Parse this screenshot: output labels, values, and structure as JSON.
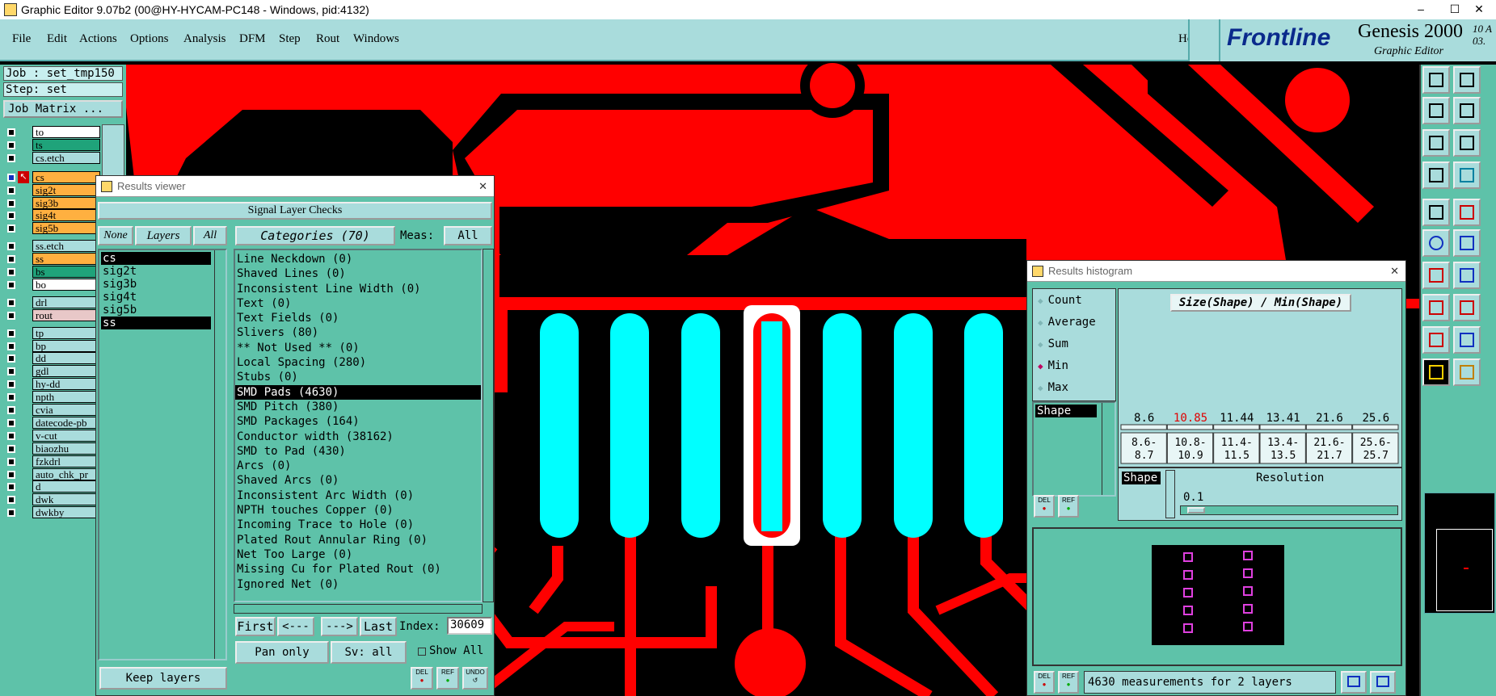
{
  "window": {
    "title": "Graphic Editor 9.07b2 (00@HY-HYCAM-PC148 - Windows, pid:4132)",
    "controls": [
      "–",
      "☐",
      "✕"
    ]
  },
  "menu": {
    "items": [
      "File",
      "Edit",
      "Actions",
      "Options",
      "Analysis",
      "DFM",
      "Step",
      "Rout",
      "Windows"
    ],
    "help": "Help"
  },
  "brand": {
    "logo": "Frontline",
    "product": "Genesis 2000",
    "subtitle": "Graphic Editor",
    "version_line1": "10 A",
    "version_line2": "03."
  },
  "job": {
    "job_label": "Job : set_tmp150",
    "step_label": "Step: set",
    "matrix_button": "Job Matrix ..."
  },
  "layers": [
    {
      "name": "to",
      "color": "#ffffff",
      "row": 0
    },
    {
      "name": "ts",
      "color": "#1fa37a",
      "row": 1
    },
    {
      "name": "cs.etch",
      "color": "#a9dcdc",
      "row": 2
    },
    {
      "name": "cs",
      "color": "#ffb040",
      "row": 3,
      "active": true
    },
    {
      "name": "sig2t",
      "color": "#ffb040",
      "row": 4
    },
    {
      "name": "sig3b",
      "color": "#ffb040",
      "row": 5
    },
    {
      "name": "sig4t",
      "color": "#ffb040",
      "row": 6
    },
    {
      "name": "sig5b",
      "color": "#ffb040",
      "row": 7
    },
    {
      "name": "ss.etch",
      "color": "#a9dcdc",
      "row": 8
    },
    {
      "name": "ss",
      "color": "#ffb040",
      "row": 9
    },
    {
      "name": "bs",
      "color": "#1fa37a",
      "row": 10
    },
    {
      "name": "bo",
      "color": "#ffffff",
      "row": 11
    },
    {
      "name": "drl",
      "color": "#a9dcdc",
      "row": 12
    },
    {
      "name": "rout",
      "color": "#e8c8c8",
      "row": 13
    },
    {
      "name": "tp",
      "color": "#a9dcdc",
      "row": 14
    },
    {
      "name": "bp",
      "color": "#a9dcdc",
      "row": 15
    },
    {
      "name": "dd",
      "color": "#a9dcdc",
      "row": 16
    },
    {
      "name": "gdl",
      "color": "#a9dcdc",
      "row": 17
    },
    {
      "name": "hy-dd",
      "color": "#a9dcdc",
      "row": 18
    },
    {
      "name": "npth",
      "color": "#a9dcdc",
      "row": 19
    },
    {
      "name": "cvia",
      "color": "#a9dcdc",
      "row": 20
    },
    {
      "name": "datecode-pb",
      "color": "#a9dcdc",
      "row": 21
    },
    {
      "name": "v-cut",
      "color": "#a9dcdc",
      "row": 22
    },
    {
      "name": "biaozhu",
      "color": "#a9dcdc",
      "row": 23
    },
    {
      "name": "fzkdrl",
      "color": "#a9dcdc",
      "row": 24
    },
    {
      "name": "auto_chk_pr",
      "color": "#a9dcdc",
      "row": 25
    },
    {
      "name": "d",
      "color": "#a9dcdc",
      "row": 26
    },
    {
      "name": "dwk",
      "color": "#a9dcdc",
      "row": 27
    },
    {
      "name": "dwkby",
      "color": "#a9dcdc",
      "row": 28
    }
  ],
  "results_viewer": {
    "title": "Results viewer",
    "header": "Signal Layer Checks",
    "none_btn": "None",
    "layers_btn": "Layers",
    "all_btn": "All",
    "layer_list": [
      "cs",
      "sig2t",
      "sig3b",
      "sig4t",
      "sig5b",
      "ss"
    ],
    "categories_label": "Categories (70)",
    "meas_label": "Meas:",
    "meas_value": "All",
    "categories": [
      "Line Neckdown (0)",
      "Shaved Lines (0)",
      "Inconsistent Line Width (0)",
      "Text (0)",
      "Text Fields (0)",
      "Slivers (80)",
      "** Not Used ** (0)",
      "Local Spacing (280)",
      "Stubs (0)",
      "SMD Pads (4630)",
      "SMD Pitch (380)",
      "SMD Packages (164)",
      "Conductor width (38162)",
      "SMD to Pad (430)",
      "Arcs (0)",
      "Shaved Arcs (0)",
      "Inconsistent Arc Width (0)",
      "NPTH touches Copper (0)",
      "Incoming Trace to Hole (0)",
      "Plated Rout Annular Ring (0)",
      "Net Too Large (0)",
      "Missing Cu for Plated Rout (0)",
      "Ignored Net (0)"
    ],
    "selected_category_index": 9,
    "first_btn": "First",
    "prev_btn": "<---",
    "next_btn": "--->",
    "last_btn": "Last",
    "index_label": "Index:",
    "index_value": "30609",
    "pan_value": "Pan only",
    "sv_label": "Sv:",
    "sv_value": "all",
    "show_all": "Show All",
    "keep_layers": "Keep layers",
    "del_btn": "DEL",
    "ref_btn": "REF",
    "undo_btn": "UNDO"
  },
  "histogram": {
    "title": "Results histogram",
    "modes": [
      "Count",
      "Average",
      "Sum",
      "Min",
      "Max"
    ],
    "selected_mode": "Min",
    "chart_title": "Size(Shape) / Min(Shape)",
    "value_labels": [
      "8.6",
      "10.85",
      "11.44",
      "13.41",
      "21.6",
      "25.6"
    ],
    "highlight_index": 1,
    "bin_top": [
      "8.6-",
      "10.8-",
      "11.4-",
      "13.4-",
      "21.6-",
      "25.6-"
    ],
    "bin_bottom": [
      "8.7",
      "10.9",
      "11.5",
      "13.5",
      "21.7",
      "25.7"
    ],
    "shape_list": [
      "Shape"
    ],
    "shape_label": "Shape",
    "resolution_label": "Resolution",
    "resolution_value": "0.1",
    "status": "4630 measurements for 2 layers",
    "del_btn": "DEL",
    "ref_btn": "REF"
  },
  "colors": {
    "copper": "#ff0000",
    "pad": "#00ffff",
    "panel": "#5ec2a9",
    "panel_light": "#a9dcdc",
    "highlight": "#e00000"
  }
}
